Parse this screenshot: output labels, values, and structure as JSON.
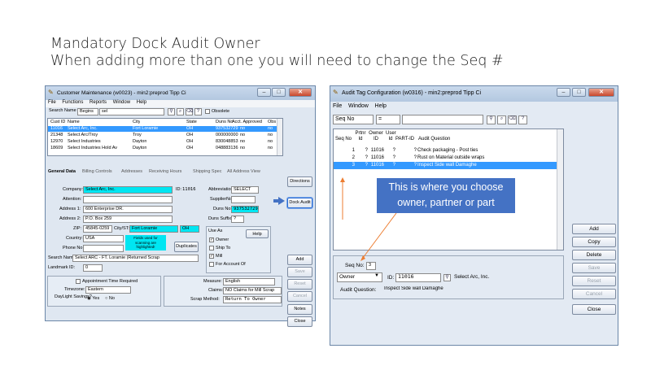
{
  "slide": {
    "title_line1": "Mandatory Dock Audit Owner",
    "title_line2": "When adding more than one you will need to change the Seq #"
  },
  "left_window": {
    "title": "Customer Maintenance (w0023) - min2:preprod Tipp Ci",
    "menu": [
      "File",
      "Functions",
      "Reports",
      "Window",
      "Help"
    ],
    "search": {
      "field": "Search Name",
      "op": "Begins",
      "value": "sel",
      "obsolete_label": "Obsolete"
    },
    "grid_headers": [
      "Cust ID",
      "Name",
      "City",
      "State",
      "Duns No",
      "Acct. Approved",
      "Obs"
    ],
    "grid_rows": [
      [
        "11016",
        "Select Arc, Inc.",
        "Fort Loramie",
        "OH",
        "937532729",
        "no",
        "no"
      ],
      [
        "21348",
        "Select Arc/Troy",
        "Troy",
        "OH",
        "000000000",
        "no",
        "no"
      ],
      [
        "12970",
        "Select Industries",
        "Dayton",
        "OH",
        "830048853",
        "no",
        "no"
      ],
      [
        "18609",
        "Select Industries Hold Av",
        "Dayton",
        "OH",
        "048883136",
        "no",
        "no"
      ]
    ],
    "tabs": [
      "General Data",
      "Billing Controls",
      "Addresses",
      "Receiving Hours",
      "Shipping Spec",
      "All Address View"
    ],
    "form": {
      "company_label": "Company:",
      "company": "Select Arc, Inc.",
      "id_label": "ID:",
      "id": "11016",
      "attention_label": "Attention:",
      "address1_label": "Address 1:",
      "address1": "600 Enterprise DR.",
      "address2_label": "Address 2:",
      "address2": "P.O. Box 259",
      "zip_label": "ZIP:",
      "zip": "45845-0259",
      "citystate_label": "City/ST:",
      "city": "Fort Loramie",
      "state": "OH",
      "country_label": "Country:",
      "country": "USA",
      "phone_label": "Phone No:",
      "note": "Fields used for scanning are highlighted!",
      "duplicates": "Duplicates",
      "searchname_label": "Search Name:",
      "searchname": "Select ARC - FT. Loramie (Returned Scrap",
      "landmark_label": "Landmark ID:",
      "landmark": "0",
      "abbrev_label": "Abbreviation:",
      "abbrev": "SELECT",
      "supplier_label": "SupplierNo:",
      "duns_label": "Duns No:",
      "duns": "937532729",
      "suffix_label": "Duns Suffix:",
      "suffix": "?",
      "use_as_label": "Use As",
      "help": "Help",
      "use_owner": "Owner",
      "use_ship": "Ship To",
      "use_mill": "Mill",
      "use_account": "For Account Of",
      "appt_label": "Appointment Time Required",
      "tz_label": "Timezone:",
      "tz": "Eastern",
      "dst_label": "DayLight Savings?",
      "dst_yes": "Yes",
      "dst_no": "No",
      "measure_label": "Measure:",
      "measure": "English",
      "claims_label": "Claims:",
      "claims": "NO Claims for Mill Scrap",
      "scrap_label": "Scrap Method:",
      "scrap": "Return To Owner"
    },
    "buttons": {
      "directions": "Directions",
      "dock_audit": "Dock Audit",
      "add": "Add",
      "save": "Save",
      "reset": "Reset",
      "cancel": "Cancel",
      "notes": "Notes",
      "close": "Close"
    }
  },
  "right_window": {
    "title": "Audit Tag Configuration (w0316) - min2:preprod Tipp Ci",
    "menu": [
      "File",
      "Window",
      "Help"
    ],
    "search": {
      "field": "Seq No",
      "op": "="
    },
    "headers": {
      "seq_no": "Seq No",
      "prtnr_id": "Prtnr Id",
      "owner_id": "Owner ID",
      "user_id": "User Id",
      "part_id": "PART-ID",
      "audit_question": "Audit Question"
    },
    "rows": [
      {
        "seq": "1",
        "prtnr": "?",
        "owner": "11016",
        "user": "?",
        "part": "?",
        "q": "Check packaging - Post ties"
      },
      {
        "seq": "2",
        "prtnr": "?",
        "owner": "11016",
        "user": "?",
        "part": "?",
        "q": "Rust on Material outside wraps"
      },
      {
        "seq": "3",
        "prtnr": "?",
        "owner": "11016",
        "user": "?",
        "part": "?",
        "q": "Inspect Side wall Damaghe"
      }
    ],
    "form": {
      "seq_label": "Seq No:",
      "seq": "3",
      "type": "Owner",
      "id_label": "ID:",
      "id": "11016",
      "name": "Select Arc, Inc.",
      "question_label": "Audit Question:",
      "question": "Inspect Side wall Damaghe"
    },
    "buttons": {
      "add": "Add",
      "copy": "Copy",
      "delete": "Delete",
      "save": "Save",
      "reset": "Reset",
      "cancel": "Cancel",
      "close": "Close"
    }
  },
  "callout": "This is where you choose owner, partner or part",
  "colors": {
    "highlight": "#00e6f2",
    "selected_row": "#3399ff",
    "callout": "#4472c4",
    "arrow": "#ed7d31"
  }
}
